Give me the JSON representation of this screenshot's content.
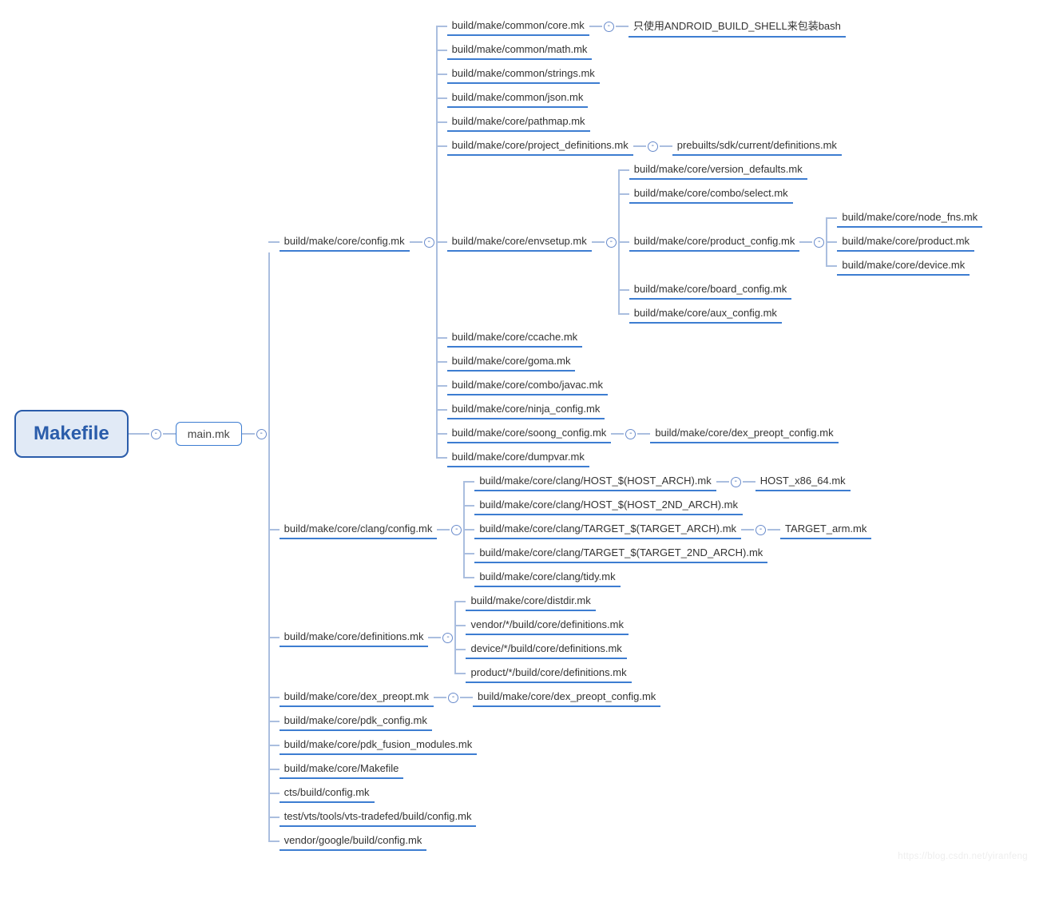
{
  "root": "Makefile",
  "main": "main.mk",
  "toggle": "-",
  "watermark": "https://blog.csdn.net/yiranfeng",
  "top": {
    "config": "build/make/core/config.mk",
    "children": {
      "core_mk": "build/make/common/core.mk",
      "core_mk_leaf": "只使用ANDROID_BUILD_SHELL来包装bash",
      "math_mk": "build/make/common/math.mk",
      "strings_mk": "build/make/common/strings.mk",
      "json_mk": "build/make/common/json.mk",
      "pathmap_mk": "build/make/core/pathmap.mk",
      "proj_def": "build/make/core/project_definitions.mk",
      "proj_def_leaf": "prebuilts/sdk/current/definitions.mk",
      "envsetup": "build/make/core/envsetup.mk",
      "env": {
        "ver_def": "build/make/core/version_defaults.mk",
        "combo_sel": "build/make/core/combo/select.mk",
        "prod_cfg": "build/make/core/product_config.mk",
        "prod_children": {
          "node_fns": "build/make/core/node_fns.mk",
          "product": "build/make/core/product.mk",
          "device": "build/make/core/device.mk"
        },
        "board_cfg": "build/make/core/board_config.mk",
        "aux_cfg": "build/make/core/aux_config.mk"
      },
      "ccache": "build/make/core/ccache.mk",
      "goma": "build/make/core/goma.mk",
      "combo_javac": "build/make/core/combo/javac.mk",
      "ninja": "build/make/core/ninja_config.mk",
      "soong": "build/make/core/soong_config.mk",
      "soong_leaf": "build/make/core/dex_preopt_config.mk",
      "dumpvar": "build/make/core/dumpvar.mk"
    }
  },
  "clang": {
    "node": "build/make/core/clang/config.mk",
    "children": {
      "host": "build/make/core/clang/HOST_$(HOST_ARCH).mk",
      "host_leaf": "HOST_x86_64.mk",
      "host2": "build/make/core/clang/HOST_$(HOST_2ND_ARCH).mk",
      "target": "build/make/core/clang/TARGET_$(TARGET_ARCH).mk",
      "target_leaf": "TARGET_arm.mk",
      "target2": "build/make/core/clang/TARGET_$(TARGET_2ND_ARCH).mk",
      "tidy": "build/make/core/clang/tidy.mk"
    }
  },
  "defs": {
    "node": "build/make/core/definitions.mk",
    "children": {
      "distdir": "build/make/core/distdir.mk",
      "vendor": "vendor/*/build/core/definitions.mk",
      "device": "device/*/build/core/definitions.mk",
      "product": "product/*/build/core/definitions.mk"
    }
  },
  "tail": {
    "dex_preopt": "build/make/core/dex_preopt.mk",
    "dex_preopt_leaf": "build/make/core/dex_preopt_config.mk",
    "pdk_cfg": "build/make/core/pdk_config.mk",
    "pdk_fusion": "build/make/core/pdk_fusion_modules.mk",
    "makefile": "build/make/core/Makefile",
    "cts": "cts/build/config.mk",
    "vts": "test/vts/tools/vts-tradefed/build/config.mk",
    "vendor_google": "vendor/google/build/config.mk"
  }
}
